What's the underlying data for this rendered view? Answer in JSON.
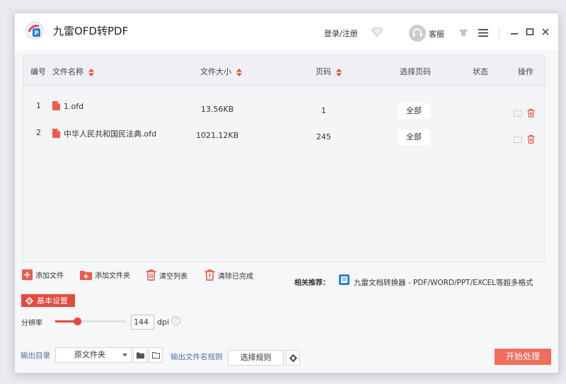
{
  "app": {
    "title": "九雷OFD转PDF"
  },
  "header": {
    "login": "登录/注册",
    "service": "客服"
  },
  "table": {
    "columns": {
      "index": "编号",
      "name": "文件名称",
      "size": "文件大小",
      "pages": "页码",
      "select_pages": "选择页码",
      "status": "状态",
      "actions": "操作"
    },
    "rows": [
      {
        "index": "1",
        "name": "1.ofd",
        "size": "13.56KB",
        "pages": "1",
        "select": "全部",
        "status": ""
      },
      {
        "index": "2",
        "name": "中华人民共和国民法典.ofd",
        "size": "1021.12KB",
        "pages": "245",
        "select": "全部",
        "status": ""
      }
    ]
  },
  "toolbar": {
    "add_file": "添加文件",
    "add_folder": "添加文件夹",
    "clear_list": "清空列表",
    "clear_done": "清除已完成"
  },
  "recommend": {
    "label": "相关推荐：",
    "link": "九雷文档转换器 - PDF/WORD/PPT/EXCEL等超多格式"
  },
  "settings": {
    "button": "基本设置",
    "resolution_label": "分辨率",
    "resolution_value": "144",
    "resolution_fraction": 0.31,
    "resolution_unit": "dpi"
  },
  "output": {
    "dir_label": "输出目录",
    "dir_value": "原文件夹",
    "rule_label": "输出文件名规则",
    "rule_button": "选择规则",
    "start_button": "开始处理"
  },
  "colors": {
    "accent": "#e8473b",
    "start": "#f06d5d",
    "link_blue": "#4a6fa5"
  }
}
